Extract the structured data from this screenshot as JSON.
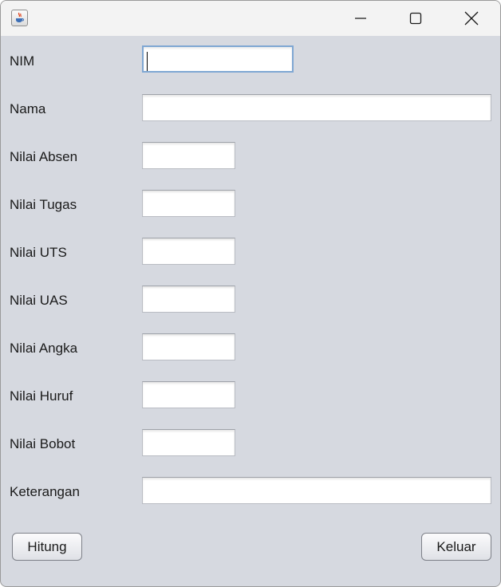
{
  "titlebar": {
    "app_icon": "java-cup-icon",
    "controls": [
      "minimize-icon",
      "maximize-icon",
      "close-icon"
    ]
  },
  "form": {
    "nim": {
      "label": "NIM",
      "value": ""
    },
    "nama": {
      "label": "Nama",
      "value": ""
    },
    "nilai_absen": {
      "label": "Nilai Absen",
      "value": ""
    },
    "nilai_tugas": {
      "label": "Nilai Tugas",
      "value": ""
    },
    "nilai_uts": {
      "label": "Nilai UTS",
      "value": ""
    },
    "nilai_uas": {
      "label": "Nilai UAS",
      "value": ""
    },
    "nilai_angka": {
      "label": "Nilai Angka",
      "value": ""
    },
    "nilai_huruf": {
      "label": "Nilai Huruf",
      "value": ""
    },
    "nilai_bobot": {
      "label": "Nilai Bobot",
      "value": ""
    },
    "keterangan": {
      "label": "Keterangan",
      "value": ""
    }
  },
  "buttons": {
    "hitung": "Hitung",
    "keluar": "Keluar"
  },
  "colors": {
    "window_bg": "#d6d9e0",
    "titlebar_bg": "#f3f3f3",
    "focus_border": "#7fa7d3"
  }
}
